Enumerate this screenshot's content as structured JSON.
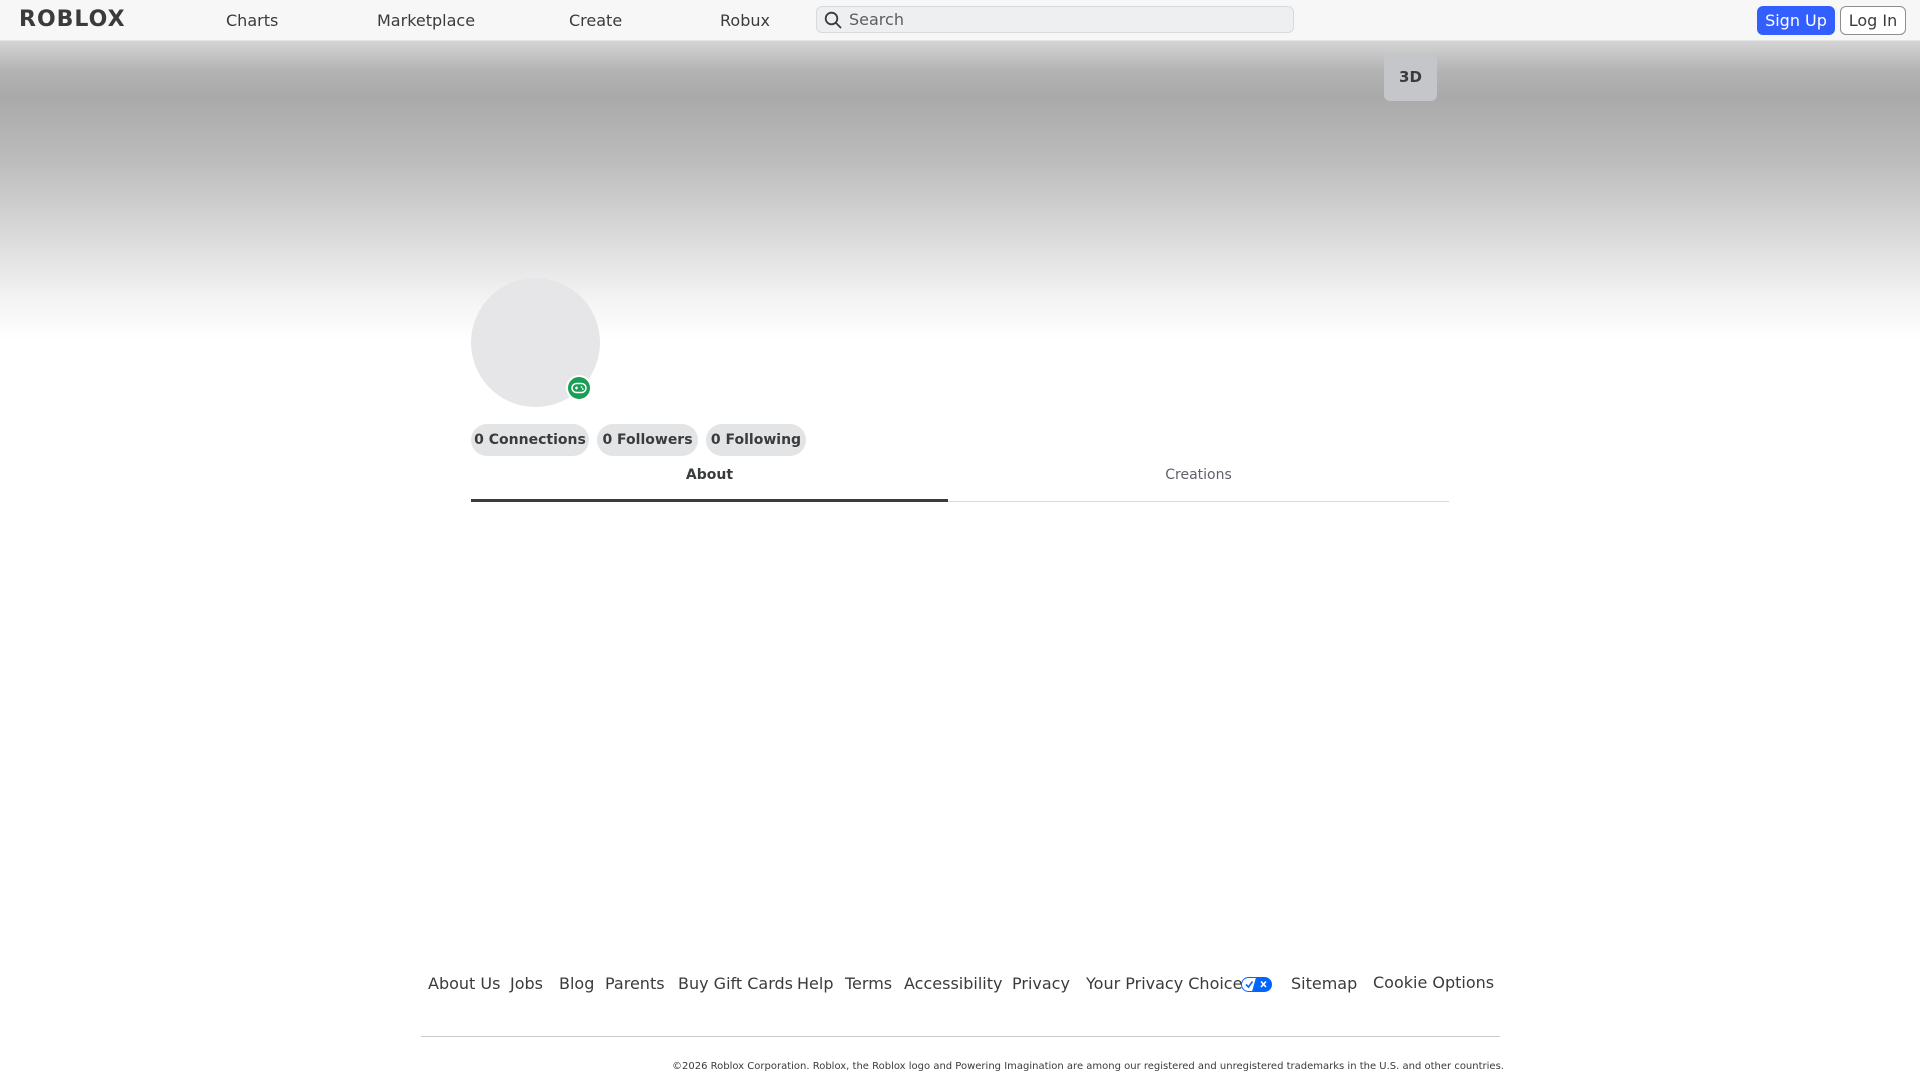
{
  "header": {
    "logo_text": "ROBLOX",
    "nav": [
      "Charts",
      "Marketplace",
      "Create",
      "Robux"
    ],
    "search_placeholder": "Search",
    "signup_label": "Sign Up",
    "login_label": "Log In"
  },
  "banner": {
    "view_3d_label": "3D"
  },
  "profile": {
    "stats": [
      "0 Connections",
      "0 Followers",
      "0 Following"
    ],
    "tabs": [
      "About",
      "Creations"
    ],
    "active_tab": "About"
  },
  "footer": {
    "links": [
      "About Us",
      "Jobs",
      "Blog",
      "Parents",
      "Buy Gift Cards",
      "Help",
      "Terms",
      "Accessibility",
      "Privacy",
      "Your Privacy Choices",
      "Sitemap",
      "Cookie Options"
    ],
    "copyright": "©2026 Roblox Corporation. Roblox, the Roblox logo and Powering Imagination are among our registered and unregistered trademarks in the U.S. and other countries."
  },
  "colors": {
    "accent": "#335fff",
    "online_status": "#1a9e55"
  }
}
